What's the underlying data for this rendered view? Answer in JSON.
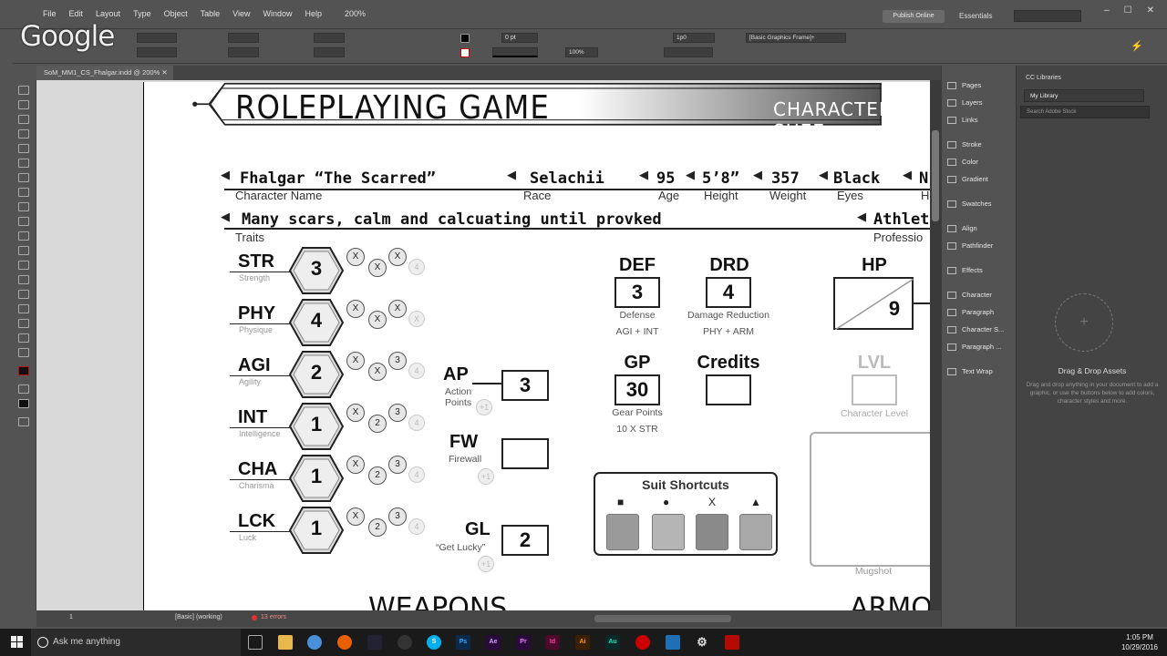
{
  "overlay": {
    "logo_text": "Google"
  },
  "menubar": {
    "items": [
      "File",
      "Edit",
      "Layout",
      "Type",
      "Object",
      "Table",
      "View",
      "Window",
      "Help"
    ],
    "zoom": "200%",
    "publish": "Publish Online",
    "workspace": "Essentials"
  },
  "control": {
    "stroke_weight": "0 pt",
    "frame_style": "[Basic Graphics Frame]+",
    "opacity": "100%",
    "offset": "1p0"
  },
  "document": {
    "tab": "SoM_MM1_CS_Fhalgar.indd @ 200%"
  },
  "panels": {
    "items": [
      "Pages",
      "Layers",
      "Links",
      "Stroke",
      "Color",
      "Gradient",
      "Swatches",
      "Align",
      "Pathfinder",
      "Effects",
      "Character",
      "Paragraph",
      "Character S...",
      "Paragraph ...",
      "Text Wrap"
    ]
  },
  "library": {
    "title": "CC Libraries",
    "selected": "My Library",
    "search_placeholder": "Search Adobe Stock",
    "drop_title": "Drag & Drop Assets",
    "drop_desc": "Drag and drop anything in your document to add a graphic, or use the buttons below to add colors, character styles and more."
  },
  "status": {
    "page": "1",
    "style": "[Basic] (working)",
    "errors": "13 errors"
  },
  "taskbar": {
    "search": "Ask me anything",
    "time": "1:05 PM",
    "date": "10/29/2016"
  },
  "sheet": {
    "title": "ROLEPLAYING GAME",
    "subtitle": "CHARACTER SHEE",
    "fields": {
      "name": {
        "value": "Fhalgar “The Scarred”",
        "label": "Character Name"
      },
      "race": {
        "value": "Selachii",
        "label": "Race"
      },
      "age": {
        "value": "95",
        "label": "Age"
      },
      "height": {
        "value": "5’8”",
        "label": "Height"
      },
      "weight": {
        "value": "357",
        "label": "Weight"
      },
      "eyes": {
        "value": "Black",
        "label": "Eyes"
      },
      "hair": {
        "value": "N",
        "label": "H"
      },
      "traits": {
        "value": "Many scars, calm and calcuating until provked",
        "label": "Traits"
      },
      "profession": {
        "value": "Athlet",
        "label": "Professio"
      }
    },
    "stats": [
      {
        "abbr": "STR",
        "name": "Strength",
        "value": "3",
        "pips": [
          "X",
          "X",
          "X",
          "4"
        ]
      },
      {
        "abbr": "PHY",
        "name": "Physique",
        "value": "4",
        "pips": [
          "X",
          "X",
          "X",
          "X"
        ]
      },
      {
        "abbr": "AGI",
        "name": "Agility",
        "value": "2",
        "pips": [
          "X",
          "X",
          "3",
          "4"
        ]
      },
      {
        "abbr": "INT",
        "name": "Intelligence",
        "value": "1",
        "pips": [
          "X",
          "2",
          "3",
          "4"
        ]
      },
      {
        "abbr": "CHA",
        "name": "Charisma",
        "value": "1",
        "pips": [
          "X",
          "2",
          "3",
          "4"
        ]
      },
      {
        "abbr": "LCK",
        "name": "Luck",
        "value": "1",
        "pips": [
          "X",
          "2",
          "3",
          "4"
        ]
      }
    ],
    "ap": {
      "label": "AP",
      "sub1": "Action",
      "sub2": "Points",
      "value": "3",
      "plus": "+1"
    },
    "fw": {
      "label": "FW",
      "sub": "Firewall",
      "value": "",
      "plus": "+1"
    },
    "gl": {
      "label": "GL",
      "sub": "“Get Lucky”",
      "value": "2",
      "plus": "+1"
    },
    "def": {
      "label": "DEF",
      "value": "3",
      "sub": "Defense",
      "formula": "AGI + INT"
    },
    "drd": {
      "label": "DRD",
      "value": "4",
      "sub": "Damage Reduction",
      "formula": "PHY + ARM"
    },
    "hp": {
      "label": "HP",
      "value": "9"
    },
    "gp": {
      "label": "GP",
      "value": "30",
      "sub": "Gear Points",
      "formula": "10 X STR"
    },
    "credits": {
      "label": "Credits",
      "value": ""
    },
    "lvl": {
      "label": "LVL",
      "sub": "Character Level"
    },
    "suit": {
      "title": "Suit Shortcuts",
      "symbols": [
        "■",
        "●",
        "X",
        "▲"
      ]
    },
    "mugshot": "Mugshot",
    "sections": [
      "WEAPONS",
      "ARMO"
    ]
  }
}
